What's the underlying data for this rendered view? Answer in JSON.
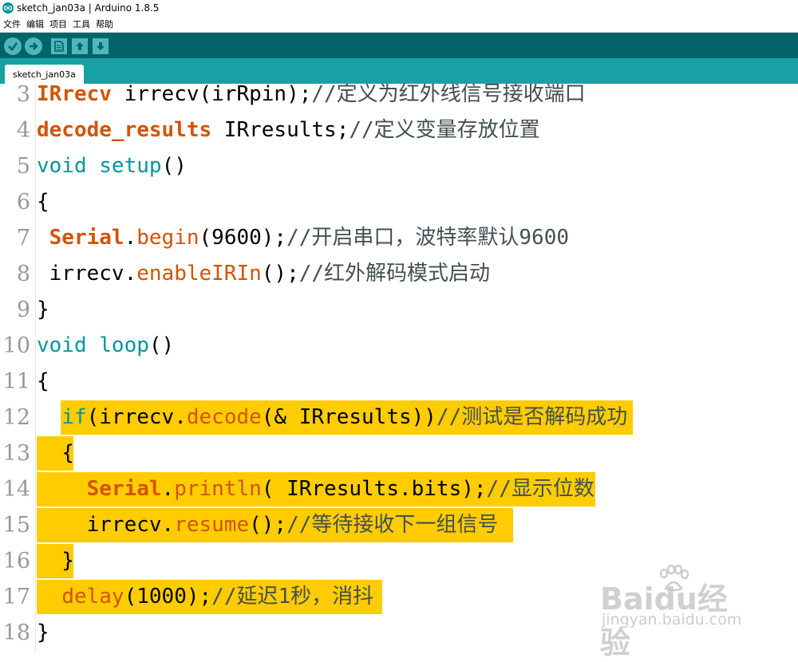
{
  "window": {
    "title": "sketch_jan03a | Arduino 1.8.5"
  },
  "menu": [
    "文件",
    "编辑",
    "项目",
    "工具",
    "帮助"
  ],
  "toolbar": {
    "buttons": [
      "verify-icon",
      "upload-icon",
      "new-icon",
      "open-icon",
      "save-icon"
    ]
  },
  "tabs": [
    {
      "label": "sketch_jan03a"
    }
  ],
  "editor": {
    "highlight_color": "#ffcc00",
    "lines": [
      {
        "num": "3",
        "text": "IRrecv irrecv(irRpin);//定义为红外线信号接收端口"
      },
      {
        "num": "4",
        "text": "decode_results IRresults;//定义变量存放位置"
      },
      {
        "num": "5",
        "text": "void setup()"
      },
      {
        "num": "6",
        "text": "{"
      },
      {
        "num": "7",
        "text": " Serial.begin(9600);//开启串口，波特率默认9600"
      },
      {
        "num": "8",
        "text": " irrecv.enableIRIn();//红外解码模式启动"
      },
      {
        "num": "9",
        "text": "}"
      },
      {
        "num": "10",
        "text": "void loop()"
      },
      {
        "num": "11",
        "text": "{"
      },
      {
        "num": "12",
        "text": "  if(irrecv.decode(& IRresults))//测试是否解码成功"
      },
      {
        "num": "13",
        "text": "  {"
      },
      {
        "num": "14",
        "text": "    Serial.println( IRresults.bits);//显示位数"
      },
      {
        "num": "15",
        "text": "    irrecv.resume();//等待接收下一组信号"
      },
      {
        "num": "16",
        "text": "  }"
      },
      {
        "num": "17",
        "text": "  delay(1000);//延迟1秒，消抖"
      },
      {
        "num": "18",
        "text": "}"
      }
    ]
  },
  "watermark": {
    "brand": "Baidu经验",
    "url": "jingyan.baidu.com"
  }
}
